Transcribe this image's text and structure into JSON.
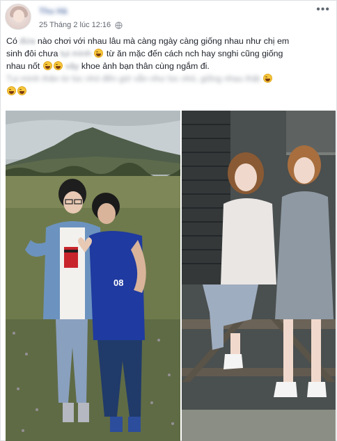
{
  "post": {
    "author": "Thu Hà",
    "timestamp": "25 Tháng 2 lúc 12:16",
    "more_icon": "more-options-icon",
    "privacy_icon": "globe-icon",
    "text": {
      "line1_a": "Có",
      "line1_blur": "đứa",
      "line1_b": "nào chơi với nhau lâu mà càng ngày càng giống nhau như chị em",
      "line2_a": "sinh đôi chưa",
      "line2_blur": "tụi mình",
      "line2_b": "từ ăn mặc đến cách nch hay snghi cũng giống",
      "line3_a": "nhau nốt",
      "line3_blur": "vậy",
      "line3_b": "khoe ảnh bạn thân cùng ngắm đi.",
      "line4_blur": "Tụi mình thân từ lúc nhỏ đến giờ vẫn như lúc nhỏ, giống nhau thật"
    },
    "photos": [
      {
        "name": "childhood-friends-photo",
        "label": "08"
      },
      {
        "name": "grown-up-friends-photo"
      }
    ]
  }
}
